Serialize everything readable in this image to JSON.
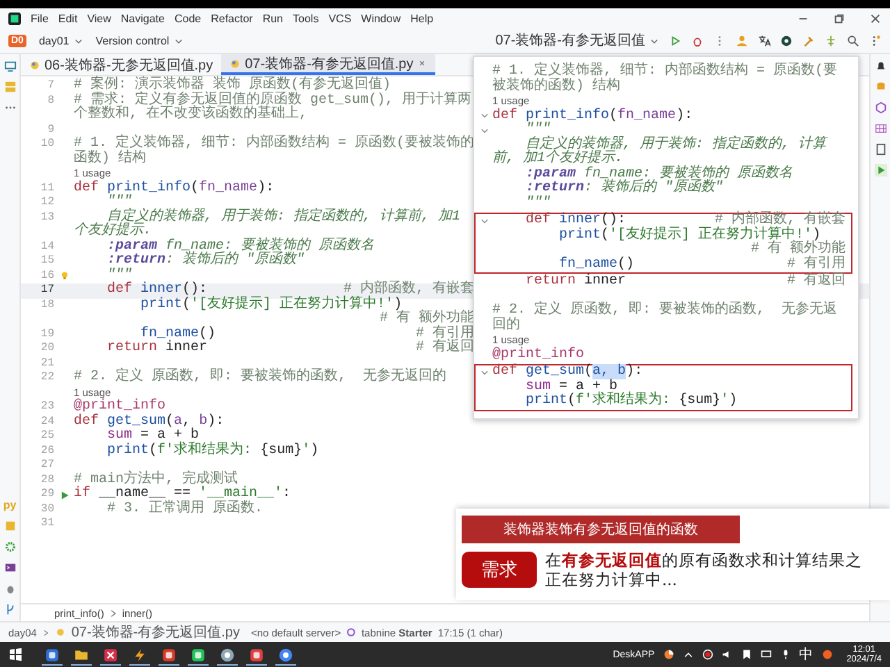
{
  "menu": {
    "items": [
      "File",
      "Edit",
      "View",
      "Navigate",
      "Code",
      "Refactor",
      "Run",
      "Tools",
      "VCS",
      "Window",
      "Help"
    ]
  },
  "toolbar": {
    "project_badge": "D0",
    "project": "day01",
    "vcs": "Version control",
    "run_config": "07-装饰器-有参无返回值"
  },
  "tool_strip": {
    "python_label": "py"
  },
  "tabs": [
    {
      "label": "06-装饰器-无参无返回值.py",
      "selected": false
    },
    {
      "label": "07-装饰器-有参无返回值.py",
      "selected": true
    }
  ],
  "editor": {
    "lines": [
      {
        "kind": "code",
        "num": "7",
        "current": false,
        "code": [
          {
            "kind": "c",
            "text": "# 案例: 演示装饰器 装饰 原函数(有参无返回值)"
          }
        ]
      },
      {
        "kind": "code",
        "num": "8",
        "current": false,
        "code": [
          {
            "kind": "c",
            "text": "# 需求: 定义有参无返回值的原函数 get_sum(), 用于计算两个整数和, 在不改变该函数的基础上,"
          }
        ]
      },
      {
        "kind": "code",
        "num": "9",
        "current": false
      },
      {
        "kind": "code",
        "num": "10",
        "current": false,
        "code": [
          {
            "kind": "c",
            "text": "# 1. 定义装饰器, 细节: 内部函数结构 = 原函数(要被装饰的函数) 结构"
          }
        ]
      },
      {
        "kind": "usage",
        "text": "1 usage"
      },
      {
        "kind": "code",
        "num": "11",
        "current": false,
        "code": [
          {
            "kind": "kw",
            "text": "def "
          },
          {
            "kind": "fn",
            "text": "print_info"
          },
          {
            "kind": "p",
            "text": "("
          },
          {
            "kind": "param",
            "text": "fn_name"
          },
          {
            "kind": "p",
            "text": "):"
          }
        ]
      },
      {
        "kind": "code",
        "num": "12",
        "current": false,
        "code": [
          {
            "kind": "doc",
            "text": "    \"\"\""
          }
        ]
      },
      {
        "kind": "code",
        "num": "13",
        "current": false,
        "code": [
          {
            "kind": "doc",
            "text": "    自定义的装饰器, 用于装饰: 指定函数的, 计算前, 加1个友好提示."
          }
        ]
      },
      {
        "kind": "code",
        "num": "14",
        "current": false,
        "code": [
          {
            "kind": "tag",
            "text": "    :param"
          },
          {
            "kind": "doc",
            "text": " fn_name: 要被装饰的 原函数名"
          }
        ]
      },
      {
        "kind": "code",
        "num": "15",
        "current": false,
        "code": [
          {
            "kind": "tag",
            "text": "    :return"
          },
          {
            "kind": "doc",
            "text": ": 装饰后的 \"原函数\""
          }
        ]
      },
      {
        "kind": "code",
        "num": "16",
        "current": false,
        "gutter": {
          "kind": "bulb"
        },
        "code": [
          {
            "kind": "doc",
            "text": "    \"\"\""
          }
        ]
      },
      {
        "kind": "code",
        "num": "17",
        "current": true,
        "code": [
          {
            "kind": "kw",
            "text": "    def "
          },
          {
            "kind": "fn",
            "text": "inner"
          },
          {
            "kind": "p",
            "text": "():"
          }
        ],
        "comment": "# 内部函数, 有嵌套"
      },
      {
        "kind": "code",
        "num": "18",
        "current": false,
        "code": [
          {
            "kind": "fn",
            "text": "        print"
          },
          {
            "kind": "p",
            "text": "("
          },
          {
            "kind": "str",
            "text": "'[友好提示] 正在努力计算中!'"
          },
          {
            "kind": "p",
            "text": ")"
          }
        ],
        "comment": "# 有 额外功能"
      },
      {
        "kind": "code",
        "num": "19",
        "current": false,
        "code": [
          {
            "kind": "fn",
            "text": "        fn_name"
          },
          {
            "kind": "p",
            "text": "()"
          }
        ],
        "comment": "# 有引用"
      },
      {
        "kind": "code",
        "num": "20",
        "current": false,
        "code": [
          {
            "kind": "kw",
            "text": "    return "
          },
          {
            "kind": "p",
            "text": "inner"
          }
        ],
        "comment": "# 有返回"
      },
      {
        "kind": "code",
        "num": "21",
        "current": false
      },
      {
        "kind": "code",
        "num": "22",
        "current": false,
        "code": [
          {
            "kind": "c",
            "text": "# 2. 定义 原函数, 即: 要被装饰的函数,  无参无返回的"
          }
        ]
      },
      {
        "kind": "usage",
        "text": "1 usage"
      },
      {
        "kind": "code",
        "num": "23",
        "current": false,
        "code": [
          {
            "kind": "deco",
            "text": "@print_info"
          }
        ]
      },
      {
        "kind": "code",
        "num": "24",
        "current": false,
        "code": [
          {
            "kind": "kw",
            "text": "def "
          },
          {
            "kind": "fn",
            "text": "get_sum"
          },
          {
            "kind": "p",
            "text": "("
          },
          {
            "kind": "param",
            "text": "a"
          },
          {
            "kind": "p",
            "text": ", "
          },
          {
            "kind": "param",
            "text": "b"
          },
          {
            "kind": "p",
            "text": "):"
          }
        ]
      },
      {
        "kind": "code",
        "num": "25",
        "current": false,
        "code": [
          {
            "kind": "var",
            "text": "    sum"
          },
          {
            "kind": "p",
            "text": " = a + b"
          }
        ]
      },
      {
        "kind": "code",
        "num": "26",
        "current": false,
        "code": [
          {
            "kind": "fn",
            "text": "    print"
          },
          {
            "kind": "p",
            "text": "("
          },
          {
            "kind": "str",
            "text": "f'求和结果为: "
          },
          {
            "kind": "p",
            "text": "{sum}"
          },
          {
            "kind": "str",
            "text": "'"
          },
          {
            "kind": "p",
            "text": ")"
          }
        ]
      },
      {
        "kind": "code",
        "num": "27",
        "current": false
      },
      {
        "kind": "code",
        "num": "28",
        "current": false,
        "code": [
          {
            "kind": "c",
            "text": "# main方法中, 完成测试"
          }
        ]
      },
      {
        "kind": "code",
        "num": "29",
        "current": false,
        "gutter": {
          "kind": "run"
        },
        "code": [
          {
            "kind": "kw",
            "text": "if "
          },
          {
            "kind": "p",
            "text": "__name__ == "
          },
          {
            "kind": "str",
            "text": "'__main__'"
          },
          {
            "kind": "p",
            "text": ":"
          }
        ]
      },
      {
        "kind": "code",
        "num": "30",
        "current": false,
        "code": [
          {
            "kind": "c",
            "text": "    # 3. 正常调用 原函数."
          }
        ]
      },
      {
        "kind": "code",
        "num": "31",
        "current": false
      }
    ]
  },
  "breadcrumbs": [
    "print_info()",
    "inner()"
  ],
  "status_bar": {
    "path": [
      "day04",
      "07-装饰器-有参无返回值.py"
    ],
    "server": "<no default server>",
    "plugin": "tabnine",
    "plugin_tier": "Starter",
    "position": "17:15 (1 char)"
  },
  "overlay_panel": {
    "groups": [
      {
        "boxed": false,
        "rows": [
          {
            "kind": "code",
            "fold": false,
            "code": [
              {
                "kind": "c",
                "text": "# 1. 定义装饰器, 细节: 内部函数结构 = 原函数(要被装饰的函数) 结构"
              }
            ]
          },
          {
            "kind": "usage",
            "text": "1 usage"
          },
          {
            "kind": "code",
            "fold": true,
            "code": [
              {
                "kind": "kw",
                "text": "def "
              },
              {
                "kind": "fn",
                "text": "print_info"
              },
              {
                "kind": "p",
                "text": "("
              },
              {
                "kind": "param",
                "text": "fn_name"
              },
              {
                "kind": "p",
                "text": "):"
              }
            ]
          },
          {
            "kind": "code",
            "fold": true,
            "code": [
              {
                "kind": "doc",
                "text": "    \"\"\""
              }
            ]
          },
          {
            "kind": "code",
            "fold": false,
            "code": [
              {
                "kind": "doc",
                "text": "    自定义的装饰器, 用于装饰: 指定函数的, 计算前, 加1个友好提示."
              }
            ]
          },
          {
            "kind": "code",
            "fold": false,
            "code": [
              {
                "kind": "tag",
                "text": "    :param"
              },
              {
                "kind": "doc",
                "text": " fn_name: 要被装饰的 原函数名"
              }
            ]
          },
          {
            "kind": "code",
            "fold": false,
            "code": [
              {
                "kind": "tag",
                "text": "    :return"
              },
              {
                "kind": "doc",
                "text": ": 装饰后的 \"原函数\""
              }
            ]
          },
          {
            "kind": "code",
            "fold": false,
            "code": [
              {
                "kind": "doc",
                "text": "    \"\"\""
              }
            ]
          }
        ]
      },
      {
        "boxed": true,
        "rows": [
          {
            "kind": "code",
            "fold": true,
            "code": [
              {
                "kind": "kw",
                "text": "    def "
              },
              {
                "kind": "fn",
                "text": "inner"
              },
              {
                "kind": "p",
                "text": "():"
              }
            ],
            "comment": "# 内部函数, 有嵌套"
          },
          {
            "kind": "code",
            "fold": false,
            "code": [
              {
                "kind": "fn",
                "text": "        print"
              },
              {
                "kind": "p",
                "text": "("
              },
              {
                "kind": "str",
                "text": "'[友好提示] 正在努力计算中!'"
              },
              {
                "kind": "p",
                "text": ")"
              }
            ],
            "comment": "# 有 额外功能"
          },
          {
            "kind": "code",
            "fold": false,
            "code": [
              {
                "kind": "fn",
                "text": "        fn_name"
              },
              {
                "kind": "p",
                "text": "()"
              }
            ],
            "comment": "# 有引用"
          }
        ]
      },
      {
        "boxed": false,
        "rows": [
          {
            "kind": "code",
            "fold": false,
            "code": [
              {
                "kind": "kw",
                "text": "    return "
              },
              {
                "kind": "p",
                "text": "inner"
              }
            ],
            "comment": "# 有返回"
          },
          {
            "kind": "blank"
          },
          {
            "kind": "code",
            "fold": false,
            "code": [
              {
                "kind": "c",
                "text": "# 2. 定义 原函数, 即: 要被装饰的函数,  无参无返回的"
              }
            ]
          },
          {
            "kind": "usage",
            "text": "1 usage"
          },
          {
            "kind": "code",
            "fold": false,
            "code": [
              {
                "kind": "deco",
                "text": "@print_info"
              }
            ]
          }
        ]
      },
      {
        "boxed": true,
        "rows": [
          {
            "kind": "code",
            "fold": true,
            "code": [
              {
                "kind": "kw",
                "text": "def "
              },
              {
                "kind": "fn",
                "text": "get_sum"
              },
              {
                "kind": "p",
                "text": "("
              },
              {
                "kind": "sel",
                "text": "a, b"
              },
              {
                "kind": "p",
                "text": "):"
              }
            ]
          },
          {
            "kind": "code",
            "fold": false,
            "code": [
              {
                "kind": "var",
                "text": "    sum"
              },
              {
                "kind": "p",
                "text": " = a + b"
              }
            ]
          },
          {
            "kind": "code",
            "fold": false,
            "code": [
              {
                "kind": "fn",
                "text": "    print"
              },
              {
                "kind": "p",
                "text": "("
              },
              {
                "kind": "str",
                "text": "f'求和结果为: "
              },
              {
                "kind": "p",
                "text": "{sum}"
              },
              {
                "kind": "str",
                "text": "'"
              },
              {
                "kind": "p",
                "text": ")"
              }
            ]
          }
        ]
      }
    ]
  },
  "slide": {
    "title": "装饰器装饰有参无返回值的函数",
    "label": "需求",
    "lines": [
      "在**有参无返回值**的原有函数求和计算结果之",
      "正在努力计算中..."
    ]
  },
  "taskbar": {
    "apps": [
      {
        "kind": "chat"
      },
      {
        "kind": "folder"
      },
      {
        "kind": "cross"
      },
      {
        "kind": "bolt"
      },
      {
        "kind": "office"
      },
      {
        "kind": "ide"
      },
      {
        "kind": "disc"
      },
      {
        "kind": "video"
      },
      {
        "kind": "browser"
      }
    ],
    "tray_label": "DeskAPP",
    "ime": "中",
    "time": "12:01",
    "date": "2024/7/4"
  }
}
